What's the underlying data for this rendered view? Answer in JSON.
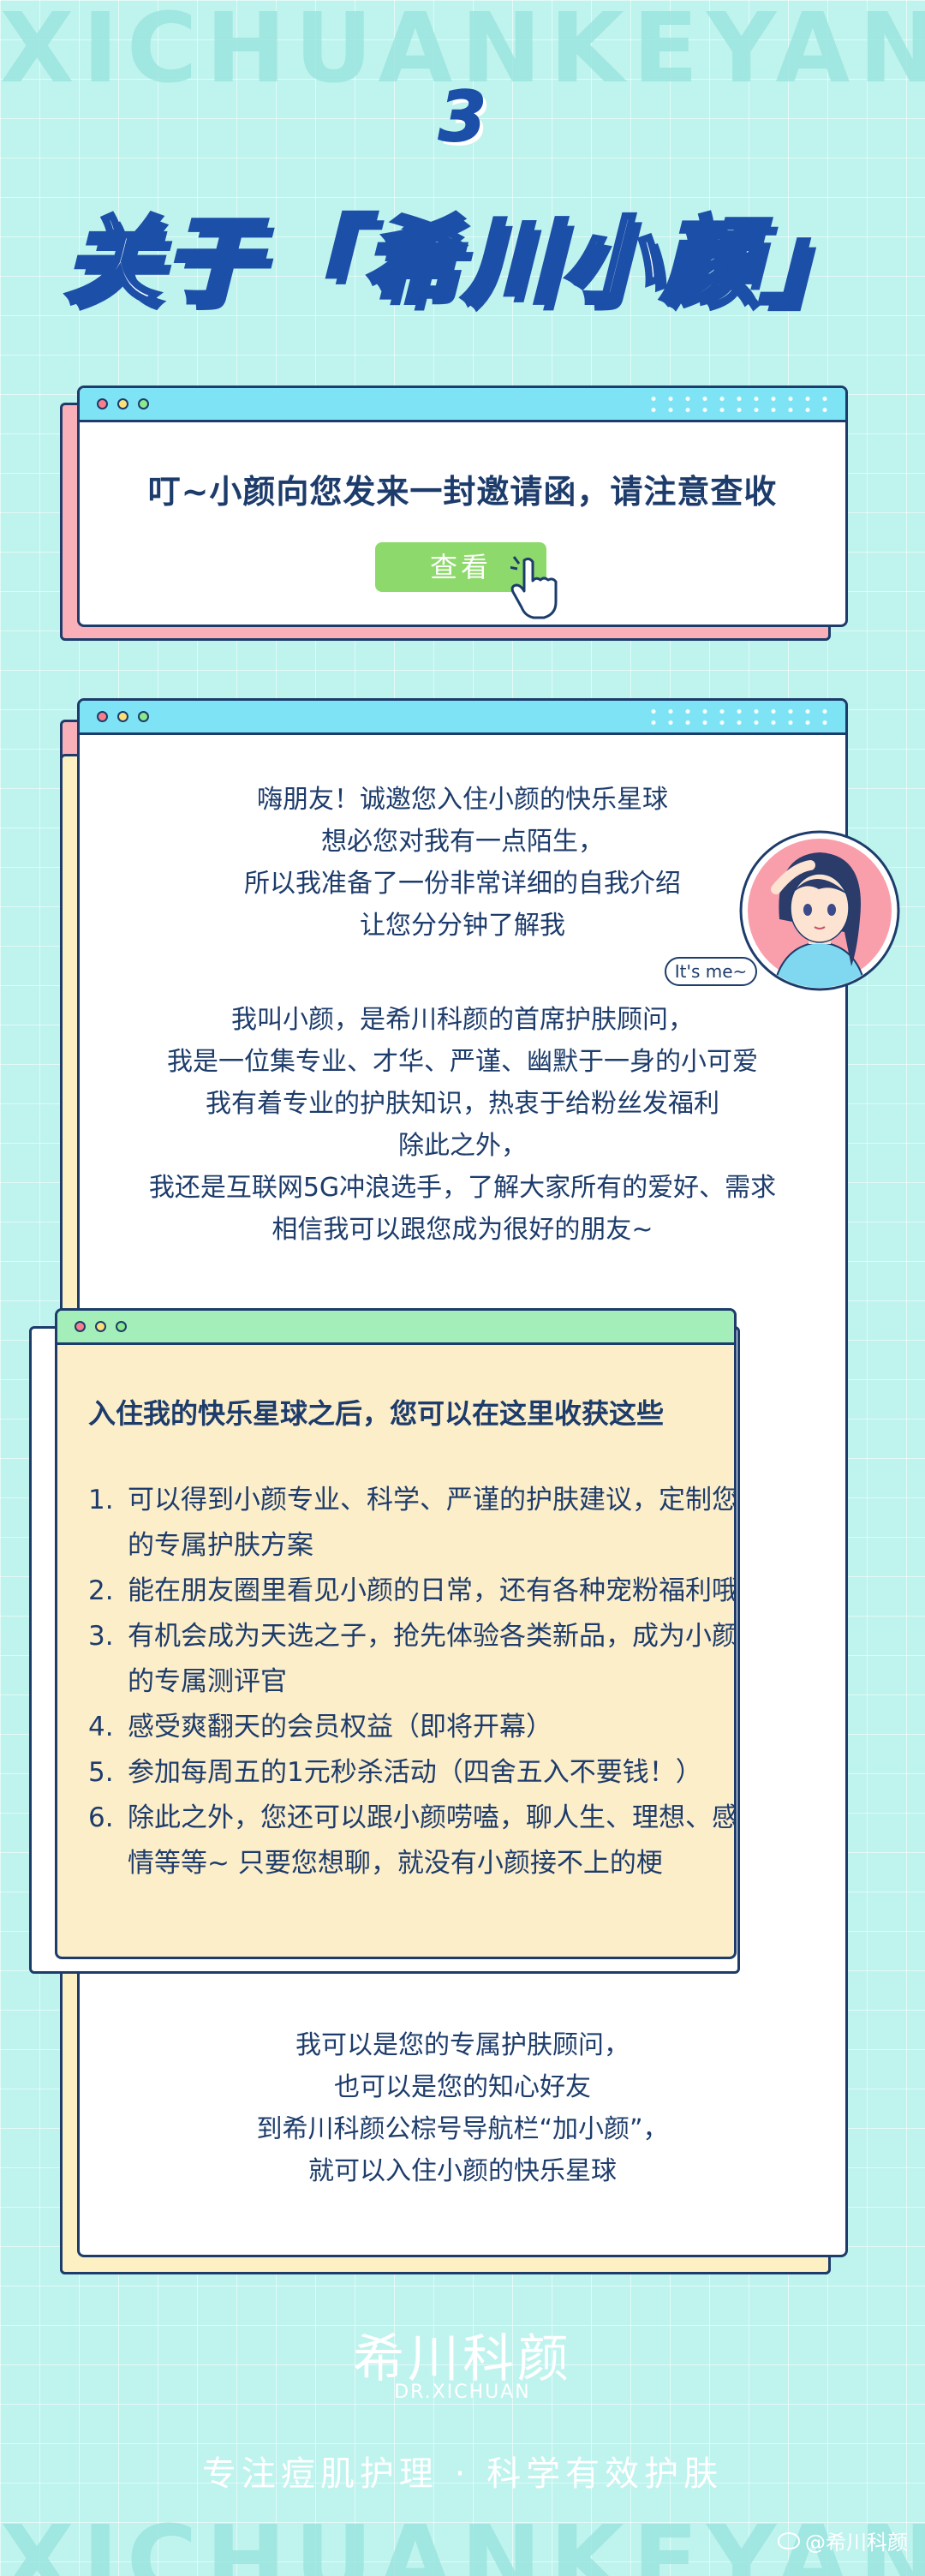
{
  "background": {
    "word": "XICHUANKEYAN",
    "color": "#bff3ee"
  },
  "header": {
    "section_number": "3",
    "title": "关于「希川小颜」"
  },
  "invite_card": {
    "message": "叮~小颜向您发来一封邀请函，请注意查收",
    "button_label": "查看",
    "button_color": "#8ed96b"
  },
  "intro_card": {
    "greeting_lines": [
      "嗨朋友！诚邀您入住小颜的快乐星球",
      "想必您对我有一点陌生，",
      "所以我准备了一份非常详细的自我介绍",
      "让您分分钟了解我"
    ],
    "avatar_tag": "It's me~",
    "about_lines": [
      "我叫小颜，是希川科颜的首席护肤顾问，",
      "我是一位集专业、才华、严谨、幽默于一身的小可爱",
      "我有着专业的护肤知识，热衷于给粉丝发福利",
      "除此之外，",
      "我还是互联网5G冲浪选手，了解大家所有的爱好、需求",
      "相信我可以跟您成为很好的朋友~"
    ],
    "closing_lines": [
      "我可以是您的专属护肤顾问，",
      "也可以是您的知心好友",
      "到希川科颜公棕号导航栏“加小颜”，",
      "就可以入住小颜的快乐星球"
    ]
  },
  "benefits_card": {
    "heading": "入住我的快乐星球之后，您可以在这里收获这些",
    "items": [
      {
        "num": "1.",
        "text": "可以得到小颜专业、科学、严谨的护肤建议，定制您的专属护肤方案"
      },
      {
        "num": "2.",
        "text": "能在朋友圈里看见小颜的日常，还有各种宠粉福利哦"
      },
      {
        "num": "3.",
        "text": "有机会成为天选之子，抢先体验各类新品，成为小颜的专属测评官"
      },
      {
        "num": "4.",
        "text": "感受爽翻天的会员权益（即将开幕）"
      },
      {
        "num": "5.",
        "text": "参加每周五的1元秒杀活动（四舍五入不要钱！）"
      },
      {
        "num": "6.",
        "text": "除此之外，您还可以跟小颜唠嗑，聊人生、理想、感情等等~ 只要您想聊，就没有小颜接不上的梗"
      }
    ]
  },
  "footer": {
    "brand": "希川科颜",
    "brand_en": "DR.XICHUAN",
    "slogan": "专注痘肌护理 · 科学有效护肤",
    "watermark": "@希川科颜"
  }
}
